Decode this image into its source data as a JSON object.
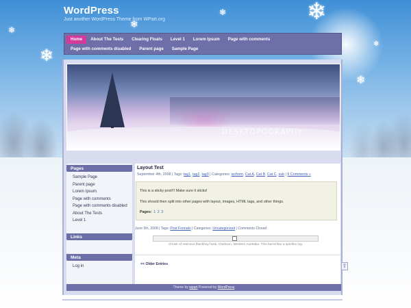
{
  "site": {
    "title": "WordPress",
    "description": "Just another WordPress Theme from WPart.org"
  },
  "nav": {
    "row1": [
      {
        "label": "Home",
        "active": true
      },
      {
        "label": "About The Tests",
        "active": false
      },
      {
        "label": "Clearing Floats",
        "active": false
      },
      {
        "label": "Level 1",
        "active": false
      },
      {
        "label": "Lorem Ipsum",
        "active": false
      },
      {
        "label": "Page with comments",
        "active": false
      }
    ],
    "row2": [
      {
        "label": "Page with comments disabled",
        "active": false
      },
      {
        "label": "Parent page",
        "active": false
      },
      {
        "label": "Sample Page",
        "active": false
      }
    ]
  },
  "header_image": {
    "watermark": "DESKTOPOGRAPHY"
  },
  "sidebar": {
    "pages_title": "Pages",
    "pages": [
      "Sample Page",
      "Parent page",
      "Lorem Ipsum",
      "Page with comments",
      "Page with comments disabled",
      "About The Tests",
      "Level 1"
    ],
    "links_title": "Links",
    "meta_title": "Meta",
    "meta": [
      "Log in"
    ]
  },
  "post": {
    "title": "Layout Test",
    "meta_prefix": "September 4th, 2008 | Tags:",
    "tags": [
      "tag1",
      "tag2",
      "tag3"
    ],
    "categories_prefix": "| Categories:",
    "categories": [
      "aciform",
      "Cat A",
      "Cat B",
      "Cat C",
      "sub"
    ],
    "comments_link": "9 Comments »",
    "sticky_line1": "This is a sticky post!!! Make sure it sticks!",
    "sticky_line2": "This should then split into other pages with layout, images, HTML tags, and other things.",
    "pages_label": "Pages:",
    "page_numbers": [
      "1",
      "2",
      "3"
    ]
  },
  "post2": {
    "meta_prefix": "June 5th, 2008 | Tags:",
    "tag": "Post Formats",
    "categories_prefix": "| Categories:",
    "category": "Uncategorized",
    "comments_text": "| Comments Closed",
    "image_caption": "Chunk of resinous blackboy husk, Clarkson, Western Australia. This burns like a spinifex log."
  },
  "older_entries": "<< Older Entries",
  "footer": {
    "prefix": "Theme by",
    "theme_author": "wpart",
    "powered": "Powered by",
    "powered_link": "WordPress"
  },
  "colors": {
    "nav_bg": "#6e6fa8",
    "nav_active": "#d5399b",
    "link": "#3d5fb8",
    "sticky_bg": "#f2f1e6"
  },
  "icons": {
    "snowflake": "❄",
    "image_placeholder": "image-icon",
    "scroll_top": "arrow-up-icon"
  }
}
